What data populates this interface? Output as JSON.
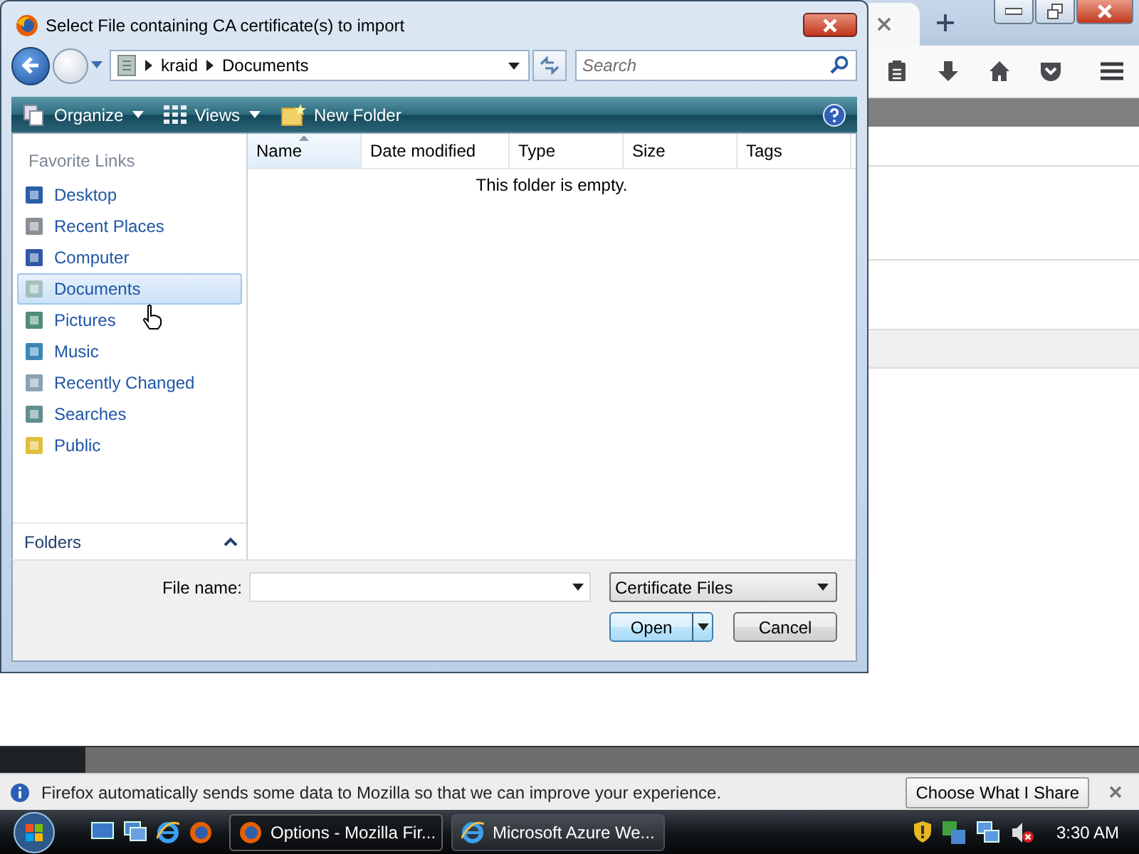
{
  "dialog": {
    "title": "Select File containing CA certificate(s) to import",
    "breadcrumb": [
      "kraid",
      "Documents"
    ],
    "search": {
      "placeholder": "Search"
    },
    "toolbar": [
      {
        "label": "Organize",
        "dropdown": true
      },
      {
        "label": "Views",
        "dropdown": true
      },
      {
        "label": "New Folder",
        "dropdown": false
      }
    ],
    "favorite_links": {
      "title": "Favorite Links",
      "items": [
        {
          "label": "Desktop",
          "selected": false
        },
        {
          "label": "Recent Places",
          "selected": false
        },
        {
          "label": "Computer",
          "selected": false
        },
        {
          "label": "Documents",
          "selected": true
        },
        {
          "label": "Pictures",
          "selected": false
        },
        {
          "label": "Music",
          "selected": false
        },
        {
          "label": "Recently Changed",
          "selected": false
        },
        {
          "label": "Searches",
          "selected": false
        },
        {
          "label": "Public",
          "selected": false
        }
      ]
    },
    "folders_label": "Folders",
    "columns": [
      {
        "label": "Name",
        "sorted": true
      },
      {
        "label": "Date modified",
        "sorted": false
      },
      {
        "label": "Type",
        "sorted": false
      },
      {
        "label": "Size",
        "sorted": false
      },
      {
        "label": "Tags",
        "sorted": false
      }
    ],
    "empty_message": "This folder is empty.",
    "file_name_label": "File name:",
    "file_type": "Certificate Files",
    "buttons": [
      "Open",
      "Cancel"
    ]
  },
  "notification": {
    "message": "Firefox automatically sends some data to Mozilla so that we can improve your experience.",
    "button": "Choose What I Share"
  },
  "taskbar": {
    "tasks": [
      {
        "label": "Options - Mozilla Fir...",
        "selected": true
      },
      {
        "label": "Microsoft Azure We...",
        "selected": false
      }
    ],
    "clock": "3:30 AM"
  }
}
